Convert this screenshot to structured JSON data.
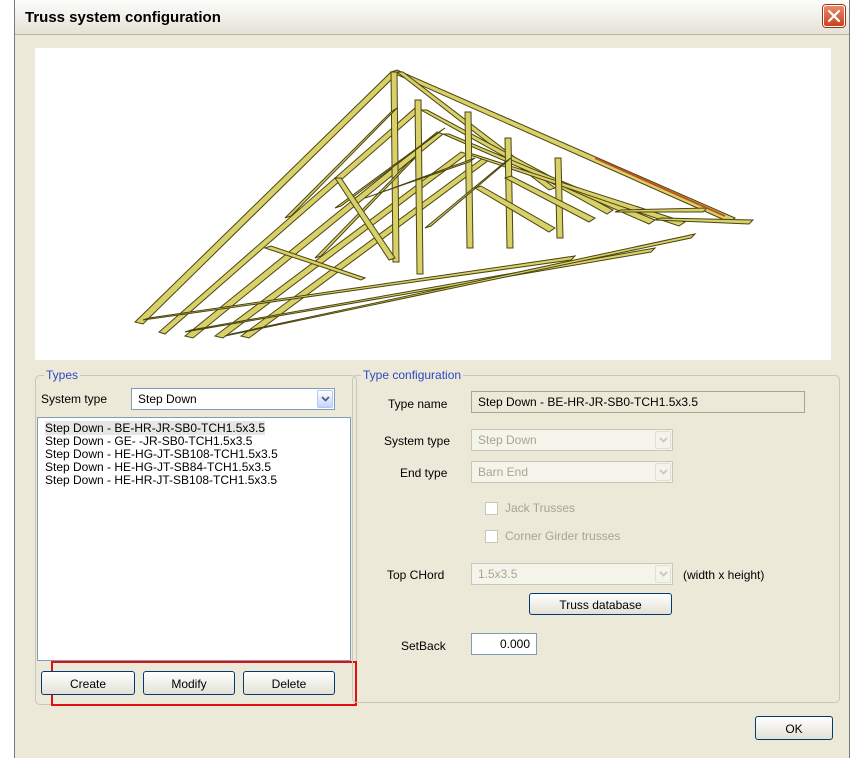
{
  "window": {
    "title": "Truss system configuration"
  },
  "types": {
    "legend": "Types",
    "system_type_label": "System type",
    "system_type_value": "Step Down",
    "list": [
      "Step Down - BE-HR-JR-SB0-TCH1.5x3.5",
      "Step Down - GE-  -JR-SB0-TCH1.5x3.5",
      "Step Down - HE-HG-JT-SB108-TCH1.5x3.5",
      "Step Down - HE-HG-JT-SB84-TCH1.5x3.5",
      "Step Down - HE-HR-JT-SB108-TCH1.5x3.5"
    ],
    "selected_index": 0,
    "buttons": {
      "create": "Create",
      "modify": "Modify",
      "delete": "Delete"
    }
  },
  "config": {
    "legend": "Type configuration",
    "type_name_label": "Type name",
    "type_name_value": "Step Down - BE-HR-JR-SB0-TCH1.5x3.5",
    "system_type_label": "System type",
    "system_type_value": "Step Down",
    "end_type_label": "End type",
    "end_type_value": "Barn End",
    "jack_trusses_label": "Jack Trusses",
    "corner_girder_label": "Corner Girder trusses",
    "top_chord_label": "Top CHord",
    "top_chord_value": "1.5x3.5",
    "top_chord_unit": "(width x height)",
    "truss_db_button": "Truss database",
    "setback_label": "SetBack",
    "setback_value": "0.000"
  },
  "footer": {
    "ok": "OK"
  },
  "colors": {
    "highlight": "#e01010",
    "legend": "#2e48c4",
    "truss_wood": "#d8d068"
  }
}
